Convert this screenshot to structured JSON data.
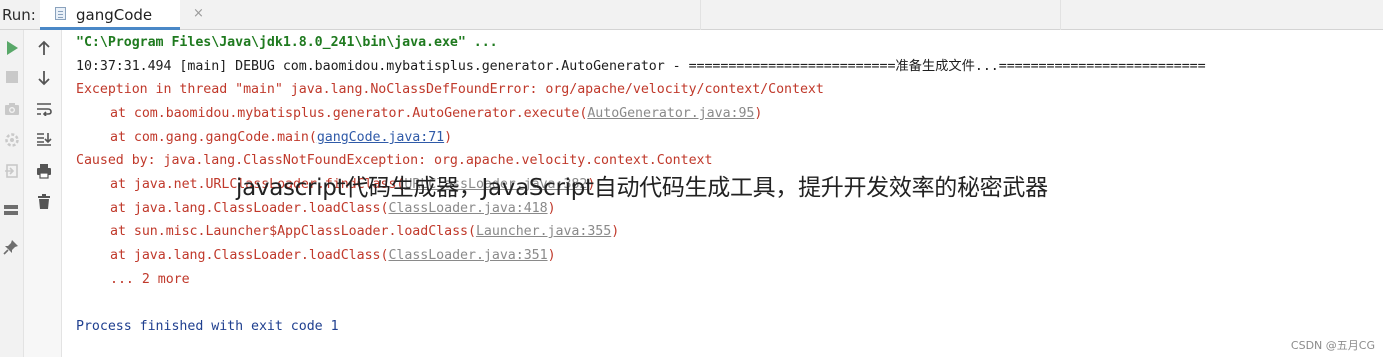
{
  "run_bar": {
    "label": "Run:",
    "tab": {
      "label": "gangCode",
      "close": "×"
    }
  },
  "toolbar_left": [
    {
      "name": "rerun-icon",
      "color": "#59a869"
    },
    {
      "name": "stop-icon",
      "color": "#c9c9c9"
    },
    {
      "name": "camera-icon",
      "color": "#c9c9c9"
    },
    {
      "name": "restore-layout-icon",
      "color": "#c9c9c9"
    },
    {
      "name": "exit-icon",
      "color": "#c9c9c9"
    },
    {
      "name": "layout-icon",
      "color": "#6e6e6e"
    },
    {
      "name": "pin-icon",
      "color": "#6e6e6e"
    }
  ],
  "toolbar_right": [
    {
      "name": "up-arrow-icon"
    },
    {
      "name": "down-arrow-icon"
    },
    {
      "name": "soft-wrap-icon"
    },
    {
      "name": "scroll-to-end-icon"
    },
    {
      "name": "print-icon"
    },
    {
      "name": "trash-icon"
    }
  ],
  "console": {
    "command": "\"C:\\Program Files\\Java\\jdk1.8.0_241\\bin\\java.exe\" ...",
    "debug": "10:37:31.494 [main] DEBUG com.baomidou.mybatisplus.generator.AutoGenerator - ==========================准备生成文件...==========================",
    "exception": "Exception in thread \"main\" java.lang.NoClassDefFoundError: org/apache/velocity/context/Context",
    "frames": [
      {
        "prefix": "at com.baomidou.mybatisplus.generator.AutoGenerator.execute(",
        "link": "AutoGenerator.java:95",
        "suffix": ")",
        "link_style": "gray"
      },
      {
        "prefix": "at com.gang.gangCode.main(",
        "link": "gangCode.java:71",
        "suffix": ")",
        "link_style": "blue"
      }
    ],
    "caused_by": "Caused by: java.lang.ClassNotFoundException: org.apache.velocity.context.Context",
    "cause_frames": [
      {
        "prefix": "at java.net.URLClassLoader.findClass(",
        "link": "URLClassLoader.java:382",
        "suffix": ")"
      },
      {
        "prefix": "at java.lang.ClassLoader.loadClass(",
        "link": "ClassLoader.java:418",
        "suffix": ")"
      },
      {
        "prefix": "at sun.misc.Launcher$AppClassLoader.loadClass(",
        "link": "Launcher.java:355",
        "suffix": ")"
      },
      {
        "prefix": "at java.lang.ClassLoader.loadClass(",
        "link": "ClassLoader.java:351",
        "suffix": ")"
      }
    ],
    "more": "... 2 more",
    "finished": "Process finished with exit code 1"
  },
  "overlay_title": "javascript代码生成器，JavaScript自动代码生成工具，提升开发效率的秘密武器",
  "watermark": "CSDN @五月CG"
}
